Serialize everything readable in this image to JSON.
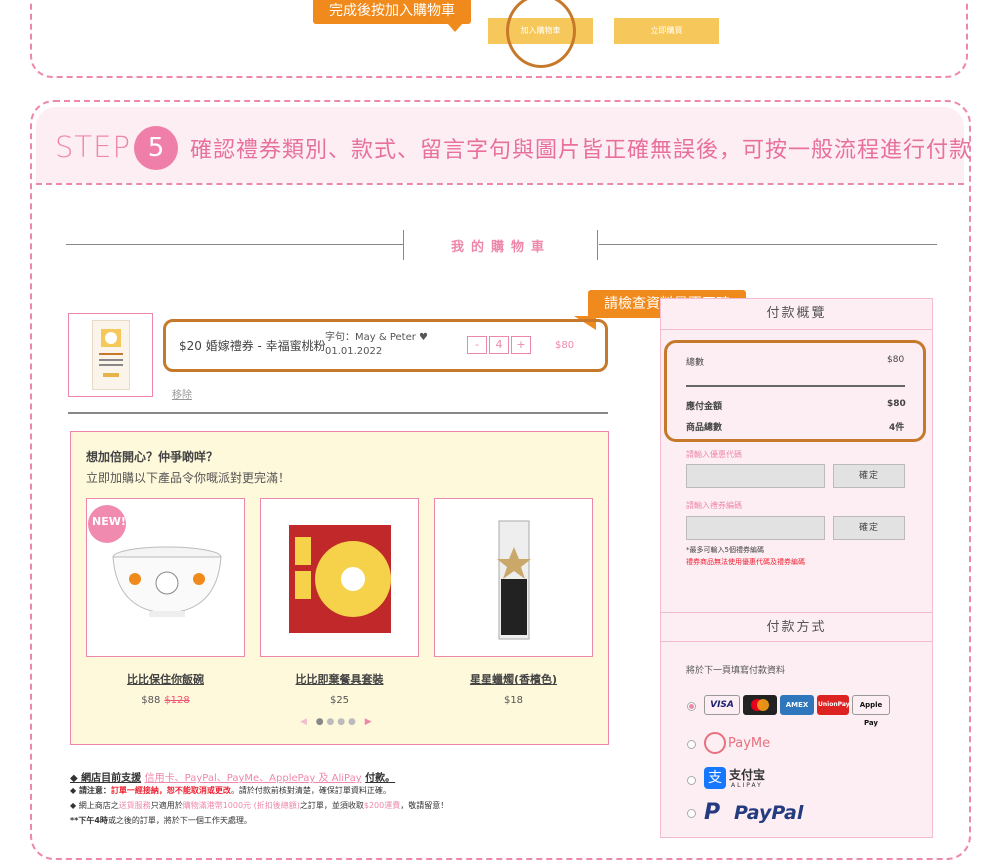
{
  "top": {
    "tip": "完成後按加入購物車",
    "add_to_cart": "加入購物車",
    "buy_now": "立即購買"
  },
  "step": {
    "word": "STEP",
    "number": "5",
    "text": "確認禮券類別、款式、留言字句與圖片皆正確無誤後，可按一般流程進行付款"
  },
  "cart": {
    "title": "我的購物車",
    "tip": "請檢查資料是否正確",
    "item": {
      "name": "$20 婚嫁禮券 - 幸福蜜桃粉",
      "message_line1": "字句：May & Peter ♥",
      "message_line2": "01.01.2022",
      "minus": "-",
      "qty": "4",
      "plus": "+",
      "price": "$80",
      "remove": "移除"
    }
  },
  "upsell": {
    "title": "想加倍開心？仲爭啲咩？",
    "subtitle": "立即加購以下產品令你嘅派對更完滿！",
    "badge": "NEW!",
    "products": [
      {
        "name": "比比保住你飯碗",
        "price": "$88",
        "old_price": "$128"
      },
      {
        "name": "比比即棄餐具套裝",
        "price": "$25",
        "old_price": ""
      },
      {
        "name": "星星蠟燭(香檳色)",
        "price": "$18",
        "old_price": ""
      }
    ],
    "prev": "◀",
    "next": "▶"
  },
  "notes": {
    "line1_prefix": "◆ 網店目前支援",
    "line1_methods": "信用卡、PayPal、PayMe、ApplePay 及 AliPay",
    "line1_suffix": "付款。",
    "line2_prefix": "◆ 請注意：",
    "line2_red": "訂單一經接納，恕不能取消或更改",
    "line2_suffix": "。請於付款前核對清楚，確保訂單資料正確。",
    "line3_a": "◆ 網上商店之",
    "line3_b": "送貨服務",
    "line3_c": "只適用於",
    "line3_d": "購物滿港幣1000元 (折扣後總額)",
    "line3_e": "之訂單，並須收取",
    "line3_f": "$200運費",
    "line3_g": "，敬請留意！",
    "line4_bold": "**下午4時",
    "line4_rest": "或之後的訂單，將於下一個工作天處理。"
  },
  "summary": {
    "title": "付款概覽",
    "total_label": "總數",
    "total_value": "$80",
    "payable_label": "應付金額",
    "payable_value": "$80",
    "items_label": "商品總數",
    "items_value": "4件",
    "coupon_label": "請輸入優惠代碼",
    "coupon_button": "確定",
    "voucher_label": "請輸入禮券編碼",
    "voucher_button": "確定",
    "voucher_note": "*最多可輸入5個禮券編碼",
    "voucher_warning": "禮券商品無法使用優惠代碼及禮券編碼"
  },
  "payment": {
    "title": "付款方式",
    "note": "將於下一頁填寫付款資料",
    "cards": [
      "VISA",
      "AMEX",
      "UnionPay",
      "Apple Pay"
    ],
    "payme": "PayMe",
    "alipay": "支付宝",
    "alipay_sub": "ALIPAY",
    "paypal": "PayPal"
  },
  "colors": {
    "pink": "#ee88aa",
    "orange": "#f08a1c",
    "brown": "#c6792a",
    "yellow": "#f6c75a"
  }
}
